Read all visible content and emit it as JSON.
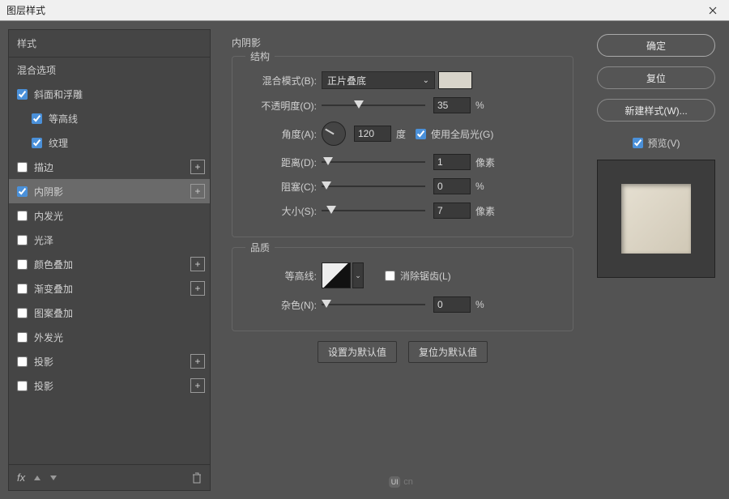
{
  "title": "图层样式",
  "left": {
    "header": "样式",
    "blend_options": "混合选项",
    "items": [
      {
        "label": "斜面和浮雕",
        "checked": true,
        "indent": false,
        "plus": false
      },
      {
        "label": "等高线",
        "checked": true,
        "indent": true,
        "plus": false
      },
      {
        "label": "纹理",
        "checked": true,
        "indent": true,
        "plus": false
      },
      {
        "label": "描边",
        "checked": false,
        "indent": false,
        "plus": true
      },
      {
        "label": "内阴影",
        "checked": true,
        "indent": false,
        "plus": true,
        "active": true
      },
      {
        "label": "内发光",
        "checked": false,
        "indent": false,
        "plus": false
      },
      {
        "label": "光泽",
        "checked": false,
        "indent": false,
        "plus": false
      },
      {
        "label": "颜色叠加",
        "checked": false,
        "indent": false,
        "plus": true
      },
      {
        "label": "渐变叠加",
        "checked": false,
        "indent": false,
        "plus": true
      },
      {
        "label": "图案叠加",
        "checked": false,
        "indent": false,
        "plus": false
      },
      {
        "label": "外发光",
        "checked": false,
        "indent": false,
        "plus": false
      },
      {
        "label": "投影",
        "checked": false,
        "indent": false,
        "plus": true
      },
      {
        "label": "投影",
        "checked": false,
        "indent": false,
        "plus": true
      }
    ],
    "fx": "fx"
  },
  "center": {
    "title": "内阴影",
    "structure_label": "结构",
    "blend_mode_label": "混合模式(B):",
    "blend_mode_value": "正片叠底",
    "opacity_label": "不透明度(O):",
    "opacity_value": "35",
    "opacity_unit": "%",
    "angle_label": "角度(A):",
    "angle_value": "120",
    "angle_unit": "度",
    "global_light_label": "使用全局光(G)",
    "distance_label": "距离(D):",
    "distance_value": "1",
    "distance_unit": "像素",
    "choke_label": "阻塞(C):",
    "choke_value": "0",
    "choke_unit": "%",
    "size_label": "大小(S):",
    "size_value": "7",
    "size_unit": "像素",
    "quality_label": "品质",
    "contour_label": "等高线:",
    "antialias_label": "消除锯齿(L)",
    "noise_label": "杂色(N):",
    "noise_value": "0",
    "noise_unit": "%",
    "set_default": "设置为默认值",
    "reset_default": "复位为默认值"
  },
  "right": {
    "ok": "确定",
    "cancel": "复位",
    "new_style": "新建样式(W)...",
    "preview": "预览(V)"
  },
  "watermark": "cn"
}
